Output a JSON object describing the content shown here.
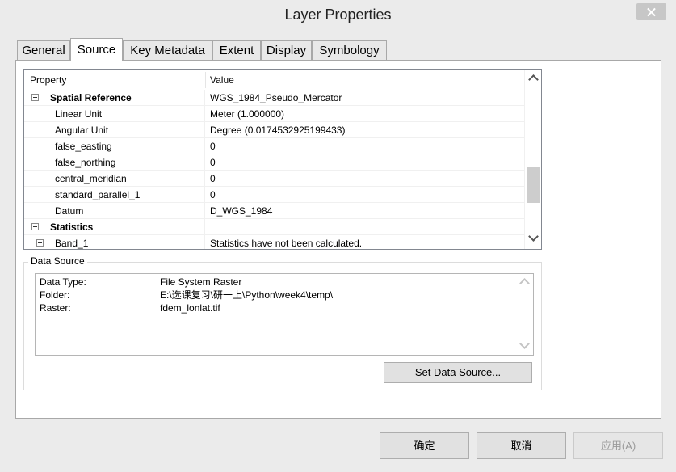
{
  "window": {
    "title": "Layer Properties"
  },
  "tabs": [
    {
      "label": "General"
    },
    {
      "label": "Source",
      "active": true
    },
    {
      "label": "Key Metadata"
    },
    {
      "label": "Extent"
    },
    {
      "label": "Display"
    },
    {
      "label": "Symbology"
    }
  ],
  "grid": {
    "columns": [
      "Property",
      "Value"
    ],
    "rows": [
      {
        "property": "Spatial Reference",
        "value": "WGS_1984_Pseudo_Mercator",
        "level": 0,
        "group": true
      },
      {
        "property": "Linear Unit",
        "value": "Meter (1.000000)",
        "level": 1
      },
      {
        "property": "Angular Unit",
        "value": "Degree (0.0174532925199433)",
        "level": 1
      },
      {
        "property": "false_easting",
        "value": "0",
        "level": 1
      },
      {
        "property": "false_northing",
        "value": "0",
        "level": 1
      },
      {
        "property": "central_meridian",
        "value": "0",
        "level": 1
      },
      {
        "property": "standard_parallel_1",
        "value": "0",
        "level": 1
      },
      {
        "property": "Datum",
        "value": "D_WGS_1984",
        "level": 1
      },
      {
        "property": "Statistics",
        "value": "",
        "level": 0,
        "group": true
      },
      {
        "property": "Band_1",
        "value": "Statistics have not been calculated.",
        "level": 1,
        "group": true
      }
    ]
  },
  "data_source": {
    "label": "Data Source",
    "rows": [
      {
        "key": "Data Type:",
        "value": "File System Raster"
      },
      {
        "key": "Folder:",
        "value": "E:\\选课复习\\研一上\\Python\\week4\\temp\\"
      },
      {
        "key": "Raster:",
        "value": "fdem_lonlat.tif"
      }
    ],
    "set_button": "Set Data Source..."
  },
  "buttons": {
    "ok": "确定",
    "cancel": "取消",
    "apply": "应用(A)"
  }
}
